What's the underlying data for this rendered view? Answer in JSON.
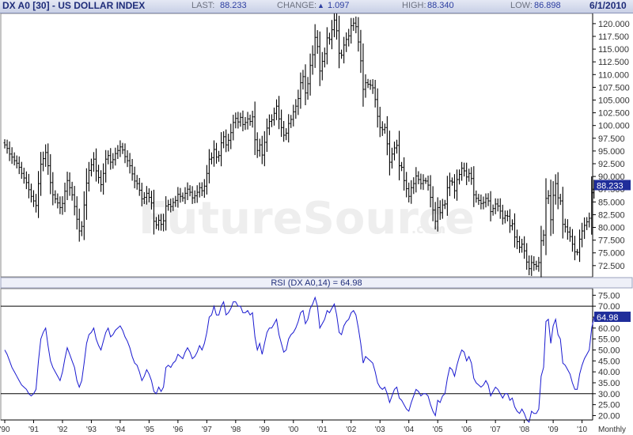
{
  "header": {
    "title": "DX A0 [30] - US DOLLAR INDEX",
    "last_label": "LAST:",
    "last_value": "88.233",
    "change_label": "CHANGE:",
    "change_value": "1.097",
    "change_arrow": "▲",
    "high_label": "HIGH:",
    "high_value": "88.340",
    "low_label": "LOW:",
    "low_value": "86.898",
    "date": "6/1/2010"
  },
  "watermark": {
    "main": "FutureSource",
    "suffix": ".com"
  },
  "rsi_title": "RSI (DX A0,14) = 64.98",
  "period_label": "Monthly",
  "colors": {
    "bars": "#000000",
    "rsi_line": "#1a1ad0",
    "badge": "#1f2d9a",
    "header_text": "#1f2d7a",
    "grid": "#000000"
  },
  "chart_data": [
    {
      "type": "ohlc",
      "name": "US Dollar Index monthly",
      "x_labels": [
        "'90",
        "'91",
        "'92",
        "'93",
        "'94",
        "'95",
        "'96",
        "'97",
        "'98",
        "'99",
        "'00",
        "'01",
        "'02",
        "'03",
        "'04",
        "'05",
        "'06",
        "'07",
        "'08",
        "'09",
        "'10"
      ],
      "y_ticks": [
        "72.500",
        "75.000",
        "77.500",
        "80.000",
        "82.500",
        "85.000",
        "87.500",
        "90.000",
        "92.500",
        "95.000",
        "97.500",
        "100.000",
        "102.500",
        "105.000",
        "107.500",
        "110.000",
        "112.500",
        "115.000",
        "117.500",
        "120.000"
      ],
      "ylim": [
        70.3,
        122
      ],
      "last_badge": "88.233",
      "closes_by_year": [
        [
          96.2,
          95.5,
          94.4,
          93.8,
          93.1,
          92.6,
          91.8,
          90.6,
          89.7,
          88.8,
          87.4,
          86.1
        ],
        [
          85.2,
          84.3,
          88.6,
          92.4,
          93.5,
          94.7,
          92.1,
          88.8,
          86.4,
          85.6,
          84.8,
          83.9
        ],
        [
          84.7,
          87.1,
          89.2,
          87.8,
          86.4,
          84.1,
          81.6,
          79.3,
          80.2,
          84.4,
          88.7,
          91.2
        ],
        [
          92.3,
          93.4,
          91.1,
          89.8,
          88.4,
          90.6,
          93.4,
          94.1,
          92.8,
          93.3,
          94.5,
          95.1
        ],
        [
          95.8,
          95.2,
          93.9,
          93.1,
          92.1,
          90.5,
          89.1,
          88.6,
          87.3,
          85.6,
          85.9,
          86.7
        ],
        [
          85.9,
          84.8,
          81.2,
          80.5,
          81.4,
          80.6,
          81.3,
          84.2,
          84.5,
          84.1,
          84.9,
          85.3
        ],
        [
          86.5,
          86.1,
          85.8,
          86.7,
          87.5,
          86.9,
          85.8,
          86.2,
          86.9,
          87.8,
          87.2,
          88.1
        ],
        [
          90.6,
          93.4,
          93.7,
          95.3,
          93.8,
          94.1,
          96.6,
          97.8,
          96.2,
          97.1,
          98.6,
          100.6
        ],
        [
          101.4,
          100.7,
          101.6,
          100.2,
          100.6,
          101.3,
          100.8,
          101.7,
          97.2,
          95.1,
          96.2,
          94.2
        ],
        [
          96.7,
          99.5,
          100.8,
          101.1,
          102.4,
          103.8,
          101.3,
          99.6,
          98.1,
          98.5,
          100.4,
          101.2
        ],
        [
          102.7,
          103.8,
          105.3,
          108.4,
          109.6,
          106.4,
          108.2,
          111.8,
          113.9,
          117.3,
          115.5,
          110.7
        ],
        [
          112.6,
          114.1,
          117.2,
          116.9,
          118.8,
          120.7,
          118.6,
          114.2,
          113.8,
          115.8,
          116.9,
          117.6
        ],
        [
          119.6,
          120.1,
          119.4,
          116.4,
          112.7,
          107.1,
          108.4,
          108.1,
          107.9,
          107.4,
          105.1,
          101.8
        ],
        [
          99.6,
          99.2,
          99.6,
          96.4,
          92.8,
          94.4,
          95.6,
          96.1,
          92.1,
          91.8,
          89.2,
          87.6
        ],
        [
          86.1,
          87.8,
          88.6,
          90.1,
          89.4,
          88.6,
          89.2,
          89.1,
          88.3,
          85.9,
          83.4,
          81.2
        ],
        [
          83.9,
          82.9,
          84.4,
          84.6,
          87.8,
          89.1,
          88.9,
          87.2,
          89.4,
          90.4,
          91.6,
          91.1
        ],
        [
          89.9,
          90.6,
          89.6,
          86.4,
          85.7,
          85.3,
          84.7,
          84.9,
          85.7,
          85.2,
          83.1,
          83.7
        ],
        [
          84.6,
          84.2,
          83.2,
          81.8,
          82.3,
          82.2,
          80.3,
          80.7,
          78.1,
          77.2,
          76.1,
          76.7
        ],
        [
          75.4,
          73.2,
          71.9,
          73.1,
          72.7,
          72.4,
          73.1,
          77.4,
          78.5,
          85.7,
          86.2,
          81.5
        ],
        [
          86.3,
          88.6,
          85.8,
          85.2,
          80.6,
          80.1,
          79.1,
          78.2,
          76.7,
          75.2,
          75.1,
          77.7
        ],
        [
          79.3,
          80.4,
          81.1,
          81.8,
          86.8,
          88.2
        ]
      ]
    },
    {
      "type": "line",
      "name": "RSI (DX A0,14)",
      "y_ticks": [
        "20.00",
        "25.00",
        "30.00",
        "35.00",
        "40.00",
        "45.00",
        "50.00",
        "55.00",
        "60.00",
        "65.00",
        "70.00",
        "75.00"
      ],
      "ylim": [
        18,
        78
      ],
      "reference_lines": [
        30,
        70
      ],
      "last_badge": "64.98",
      "values_by_year": [
        [
          50,
          48,
          45,
          42,
          40,
          38,
          36,
          34,
          33,
          32,
          30,
          29
        ],
        [
          30,
          32,
          45,
          55,
          58,
          60,
          52,
          45,
          42,
          40,
          38,
          36
        ],
        [
          40,
          46,
          51,
          48,
          45,
          42,
          36,
          33,
          36,
          44,
          53,
          57
        ],
        [
          58,
          60,
          55,
          52,
          50,
          54,
          58,
          60,
          56,
          57,
          59,
          60
        ],
        [
          61,
          59,
          56,
          54,
          51,
          47,
          44,
          43,
          40,
          36,
          38,
          41
        ],
        [
          39,
          36,
          31,
          30,
          33,
          31,
          33,
          42,
          43,
          42,
          44,
          45
        ],
        [
          48,
          47,
          46,
          49,
          51,
          49,
          46,
          47,
          49,
          52,
          50,
          53
        ],
        [
          58,
          65,
          66,
          70,
          66,
          66,
          70,
          72,
          66,
          67,
          69,
          72
        ],
        [
          72,
          70,
          70,
          67,
          67,
          68,
          66,
          67,
          56,
          50,
          53,
          48
        ],
        [
          53,
          58,
          60,
          60,
          62,
          64,
          57,
          53,
          49,
          50,
          55,
          57
        ],
        [
          58,
          60,
          63,
          67,
          68,
          62,
          64,
          69,
          71,
          74,
          70,
          60
        ],
        [
          62,
          64,
          68,
          67,
          69,
          71,
          66,
          58,
          57,
          61,
          63,
          64
        ],
        [
          67,
          68,
          66,
          60,
          53,
          44,
          47,
          46,
          45,
          44,
          40,
          35
        ],
        [
          33,
          32,
          33,
          30,
          26,
          29,
          32,
          33,
          28,
          27,
          25,
          23
        ],
        [
          22,
          26,
          29,
          32,
          31,
          29,
          30,
          30,
          29,
          25,
          22,
          20
        ],
        [
          27,
          26,
          29,
          30,
          37,
          42,
          41,
          38,
          43,
          47,
          50,
          49
        ],
        [
          45,
          47,
          44,
          37,
          35,
          34,
          33,
          34,
          36,
          34,
          29,
          31
        ],
        [
          33,
          32,
          30,
          28,
          30,
          30,
          27,
          28,
          24,
          22,
          21,
          23
        ],
        [
          21,
          18,
          17,
          22,
          21,
          21,
          23,
          38,
          42,
          63,
          64,
          53
        ],
        [
          61,
          64,
          57,
          55,
          44,
          43,
          41,
          39,
          35,
          32,
          32,
          39
        ],
        [
          43,
          46,
          48,
          50,
          60,
          64.98
        ]
      ]
    }
  ]
}
